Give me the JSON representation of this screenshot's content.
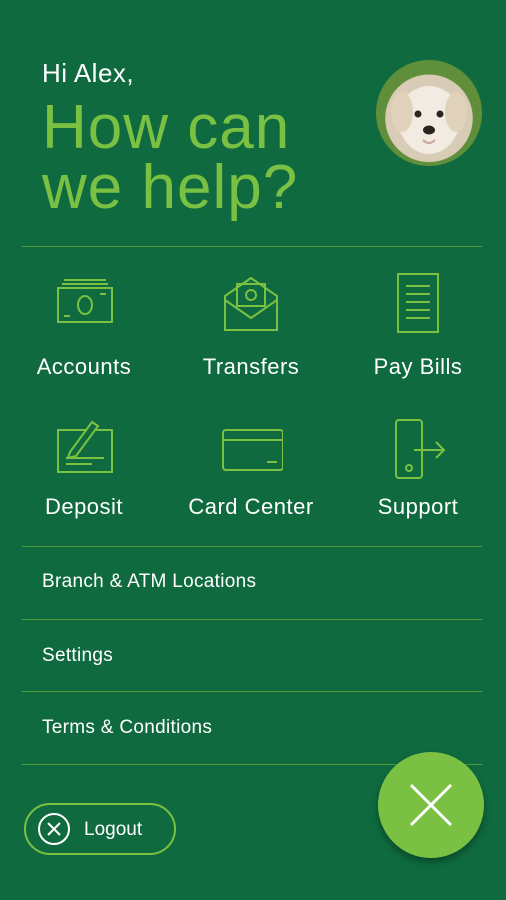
{
  "header": {
    "greeting": "Hi Alex,",
    "headline_line1": "How can",
    "headline_line2": "we help?"
  },
  "tiles": [
    {
      "label": "Accounts",
      "icon": "cash-icon"
    },
    {
      "label": "Transfers",
      "icon": "envelope-money-icon"
    },
    {
      "label": "Pay Bills",
      "icon": "bill-icon"
    },
    {
      "label": "Deposit",
      "icon": "check-pen-icon"
    },
    {
      "label": "Card Center",
      "icon": "card-icon"
    },
    {
      "label": "Support",
      "icon": "phone-arrow-icon"
    }
  ],
  "menu": {
    "branch": "Branch & ATM Locations",
    "settings": "Settings",
    "terms": "Terms & Conditions"
  },
  "logout": {
    "label": "Logout"
  },
  "colors": {
    "background": "#0f6b3f",
    "accent": "#7ac143",
    "text": "#ffffff"
  }
}
